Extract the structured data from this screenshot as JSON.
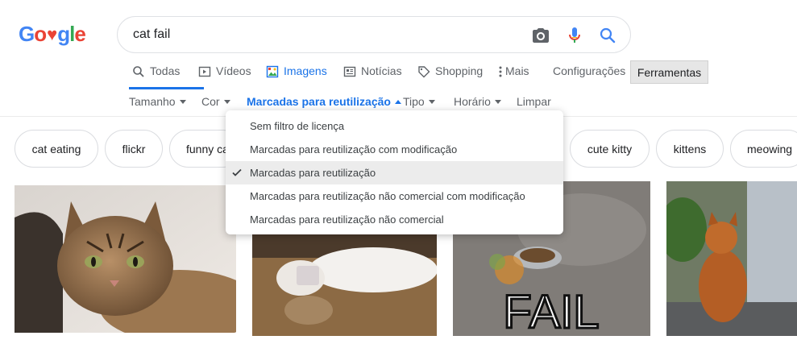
{
  "logo": {
    "letters": [
      "G",
      "o",
      "♥",
      "g",
      "l",
      "e"
    ],
    "alt": "Google"
  },
  "search": {
    "query": "cat fail"
  },
  "icons": {
    "camera": "camera-icon",
    "mic": "mic-icon",
    "search": "search-icon"
  },
  "tabs": [
    {
      "label": "Todas",
      "icon": "search-icon"
    },
    {
      "label": "Vídeos",
      "icon": "play-icon"
    },
    {
      "label": "Imagens",
      "icon": "image-icon",
      "active": true
    },
    {
      "label": "Notícias",
      "icon": "news-icon"
    },
    {
      "label": "Shopping",
      "icon": "tag-icon"
    },
    {
      "label": "Mais",
      "icon": "more-vert-icon"
    },
    {
      "label": "Configurações"
    },
    {
      "label": "Ferramentas"
    }
  ],
  "filters": [
    {
      "label": "Tamanho"
    },
    {
      "label": "Cor"
    },
    {
      "label": "Marcadas para reutilização",
      "active": true
    },
    {
      "label": "Tipo"
    },
    {
      "label": "Horário"
    },
    {
      "label": "Limpar"
    }
  ],
  "dropdown": {
    "items": [
      {
        "label": "Sem filtro de licença"
      },
      {
        "label": "Marcadas para reutilização com modificação"
      },
      {
        "label": "Marcadas para reutilização",
        "selected": true
      },
      {
        "label": "Marcadas para reutilização não comercial com modificação"
      },
      {
        "label": "Marcadas para reutilização não comercial"
      }
    ]
  },
  "chips": [
    "cat eating",
    "flickr",
    "funny ca",
    "cute kitty",
    "kittens",
    "meowing"
  ],
  "images": [
    {
      "name": "tabby-cat-image"
    },
    {
      "name": "white-cat-image"
    },
    {
      "name": "cat-fail-image",
      "caption": "FAIL"
    },
    {
      "name": "orange-cat-image"
    }
  ],
  "colors": {
    "accent": "#1a73e8",
    "selected_bg": "#ececec"
  }
}
